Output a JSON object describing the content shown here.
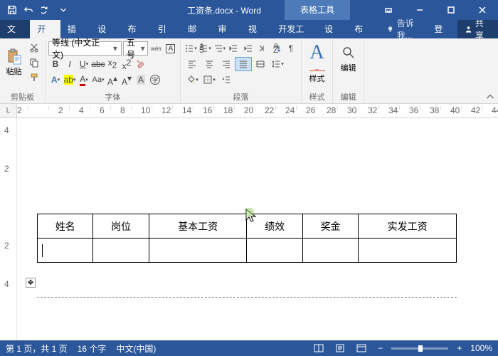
{
  "title": "工资条.docx - Word",
  "contextual_tab_title": "表格工具",
  "qat": {
    "save": "保存",
    "undo": "撤销",
    "redo": "重做",
    "customize": "自定义"
  },
  "tabs": {
    "file": "文件",
    "home": "开始",
    "insert": "插入",
    "design": "设计",
    "layout": "布局",
    "references": "引用",
    "mailings": "邮件",
    "review": "审阅",
    "view": "视图",
    "developer": "开发工具",
    "table_design": "设计",
    "table_layout": "布局"
  },
  "tell_me": "告诉我...",
  "login": "登录",
  "share": "共享",
  "ribbon": {
    "clipboard": {
      "label": "剪贴板",
      "paste": "粘贴"
    },
    "font": {
      "label": "字体",
      "name": "等线 (中文正文)",
      "size": "五号",
      "ruby": "wén",
      "charborder": "A",
      "bold": "B",
      "italic": "I",
      "underline": "U",
      "strike": "abc",
      "sub": "x₂",
      "sup": "x²"
    },
    "paragraph": {
      "label": "段落"
    },
    "styles": {
      "label": "样式",
      "text": "样式"
    },
    "editing": {
      "label": "编辑",
      "text": "编辑"
    }
  },
  "ruler_ticks": [
    "2",
    "",
    "2",
    "4",
    "6",
    "8",
    "10",
    "12",
    "14",
    "16",
    "18",
    "20",
    "22",
    "24",
    "26",
    "28",
    "30",
    "32",
    "34",
    "36",
    "38",
    "40",
    "42",
    "44"
  ],
  "vruler_ticks": [
    "4",
    "2",
    "",
    "2",
    "4"
  ],
  "ruler_corner": "L",
  "table": {
    "headers": [
      "姓名",
      "岗位",
      "基本工资",
      "绩效",
      "奖金",
      "实发工资"
    ],
    "rows": [
      [
        "",
        "",
        "",
        "",
        "",
        ""
      ]
    ]
  },
  "status": {
    "page": "第 1 页，共 1 页",
    "words": "16 个字",
    "lang": "中文(中国)",
    "zoom": "100%"
  }
}
